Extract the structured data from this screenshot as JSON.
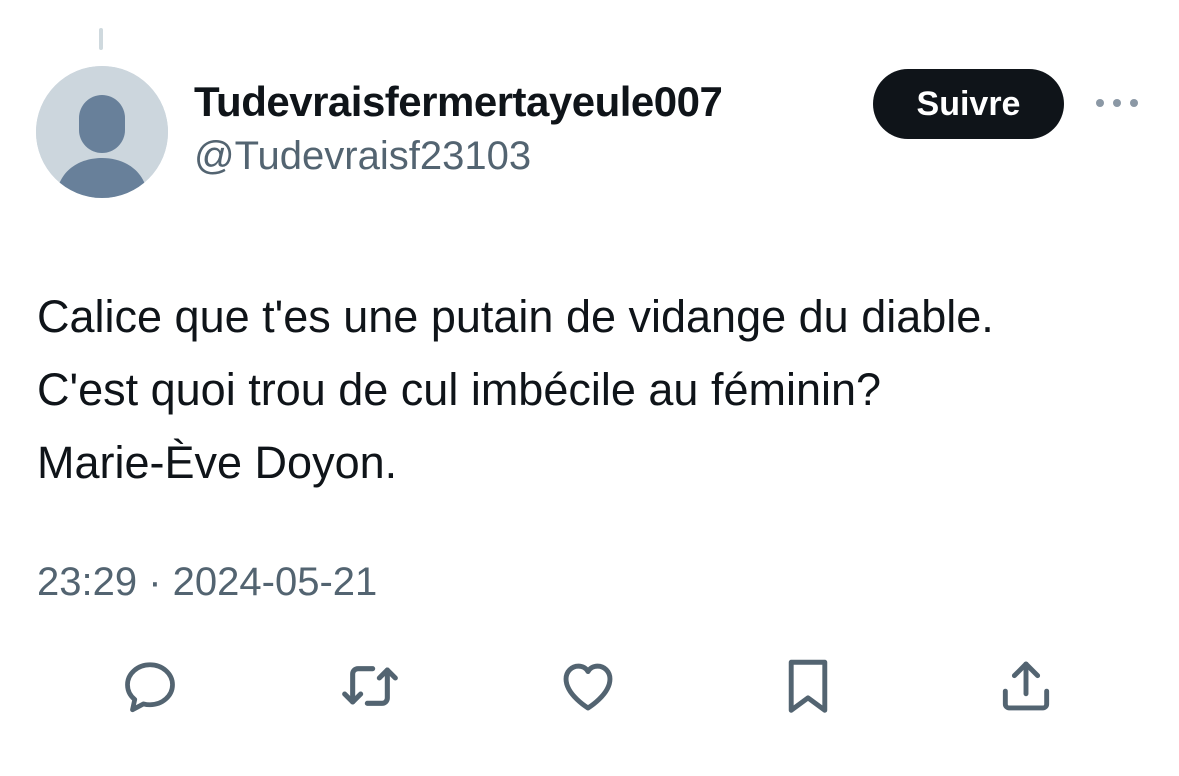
{
  "author": {
    "display_name": "Tudevraisfermertayeule007",
    "handle": "@Tudevraisf23103",
    "avatar_icon": "default-avatar-icon"
  },
  "follow_button": {
    "label": "Suivre"
  },
  "more_menu": {
    "icon": "more-horizontal-icon"
  },
  "tweet": {
    "lines": [
      "Calice que t'es une putain de vidange du diable.",
      "C'est quoi trou de cul imbécile au féminin?",
      "Marie-Ève Doyon."
    ],
    "timestamp": "23:29 · 2024-05-21"
  },
  "actions": [
    {
      "icon": "reply-icon"
    },
    {
      "icon": "retweet-icon"
    },
    {
      "icon": "like-icon"
    },
    {
      "icon": "bookmark-icon"
    },
    {
      "icon": "share-icon"
    }
  ],
  "colors": {
    "text_primary": "#0f1419",
    "text_secondary": "#536471",
    "button_bg": "#0f1419",
    "avatar_bg": "#ccd6dd",
    "avatar_figure": "#68809a",
    "thread_line": "#cfd9de"
  }
}
